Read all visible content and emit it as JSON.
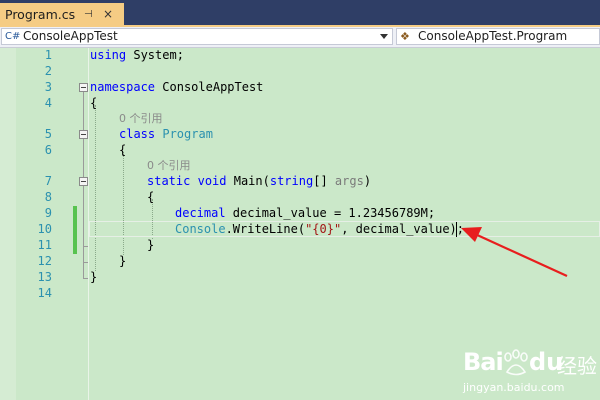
{
  "tab": {
    "title": "Program.cs",
    "pin_glyph": "⊣",
    "close_glyph": "×"
  },
  "nav": {
    "project": "ConsoleAppTest",
    "type": "ConsoleAppTest.Program",
    "project_icon": "csharp-project-icon",
    "type_icon": "class-icon"
  },
  "editor": {
    "line_numbers": [
      "1",
      "2",
      "3",
      "4",
      "5",
      "6",
      "7",
      "8",
      "9",
      "10",
      "11",
      "12",
      "13",
      "14"
    ],
    "lens_program": "0 个引用",
    "lens_main": "0 个引用",
    "tokens": {
      "using": "using",
      "system": "System;",
      "namespace": "namespace",
      "ns_name": "ConsoleAppTest",
      "brace_open": "{",
      "brace_close": "}",
      "class": "class",
      "class_name": "Program",
      "static": "static",
      "void": "void",
      "main": "Main(",
      "string": "string",
      "args_tail": "[] ",
      "args": "args",
      "rparen": ")",
      "decimal": "decimal",
      "decl_rest": " decimal_value = 1.23456789M;",
      "console": "Console",
      "writeline": ".WriteLine(",
      "fmt": "\"{0}\"",
      "call_rest": ", decimal_value);"
    }
  },
  "watermark": {
    "brand": "Bai",
    "brand2": "du",
    "jingyan": "经验",
    "url": "jingyan.baidu.com"
  },
  "colors": {
    "editor_bg": "#cbe8c9",
    "keyword": "#0000ff",
    "type": "#2b91af",
    "string": "#a31515",
    "arrow": "#e81e1e",
    "tab_active": "#f5cc84"
  }
}
